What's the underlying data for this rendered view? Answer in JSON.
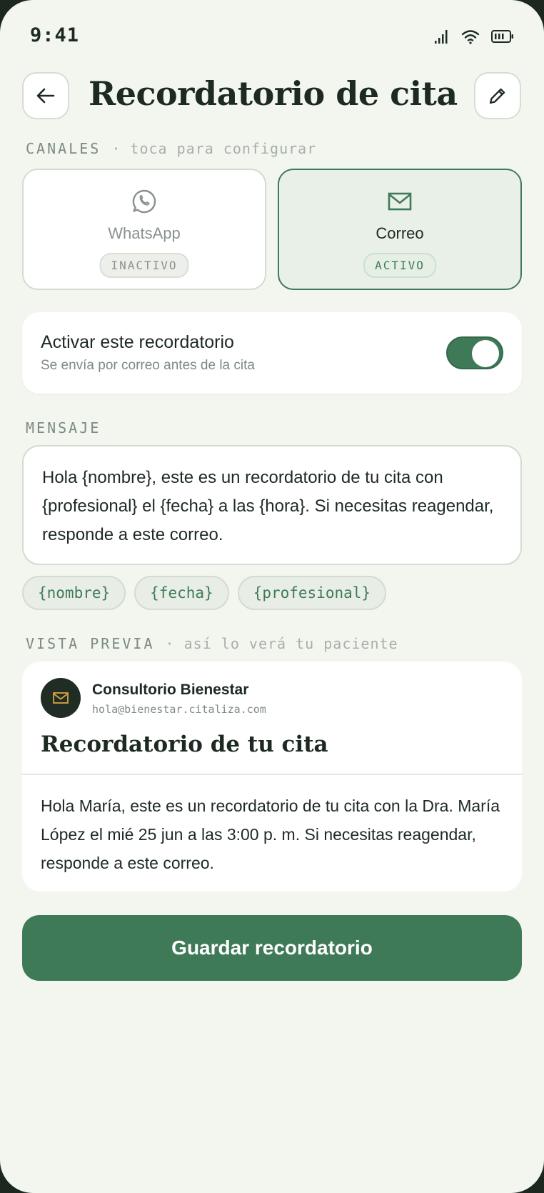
{
  "status_bar": {
    "time": "9:41"
  },
  "header": {
    "title": "Recordatorio de cita"
  },
  "channels": {
    "label": "CANALES",
    "hint": "· toca para configurar",
    "items": [
      {
        "name": "WhatsApp",
        "status": "INACTIVO",
        "icon": "whatsapp-icon",
        "active": false
      },
      {
        "name": "Correo",
        "status": "ACTIVO",
        "icon": "mail-icon",
        "active": true
      }
    ]
  },
  "toggle": {
    "title": "Activar este recordatorio",
    "subtitle": "Se envía por correo antes de la cita",
    "enabled": true
  },
  "message": {
    "label": "MENSAJE",
    "text": "Hola {nombre}, este es un recordatorio de tu cita con {profesional} el {fecha} a las {hora}. Si necesitas reagendar, responde a este correo.",
    "chips": [
      "{nombre}",
      "{fecha}",
      "{profesional}"
    ]
  },
  "preview": {
    "label": "VISTA PREVIA",
    "hint": "· así lo verá tu paciente",
    "sender_name": "Consultorio Bienestar",
    "sender_email": "hola@bienestar.citaliza.com",
    "subject": "Recordatorio de tu cita",
    "body": "Hola María, este es un recordatorio de tu cita con la Dra. María López el mié 25 jun a las 3:00 p. m. Si necesitas reagendar, responde a este correo."
  },
  "save_button": {
    "label": "Guardar recordatorio"
  },
  "colors": {
    "accent": "#3f7a58",
    "background": "#f2f6ef",
    "text": "#1d2a22",
    "avatar_bg": "#1f2d24",
    "avatar_icon": "#d9a441"
  }
}
